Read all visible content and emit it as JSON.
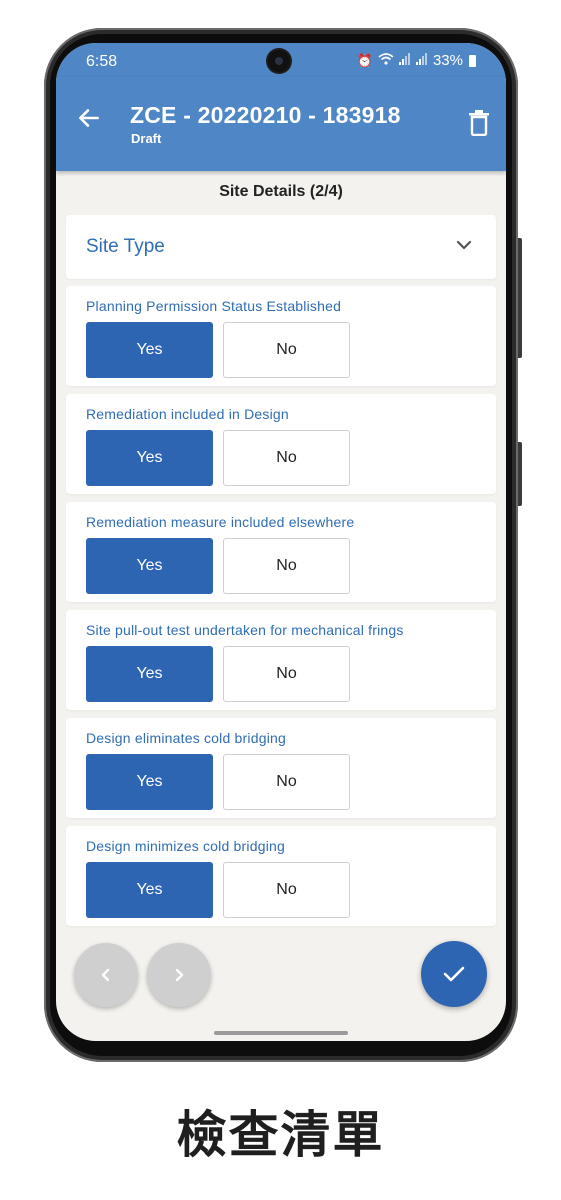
{
  "status_bar": {
    "time": "6:58",
    "battery": "33%"
  },
  "app_bar": {
    "title": "ZCE - 20220210 - 183918",
    "subtitle": "Draft"
  },
  "step": {
    "title": "Site Details (2/4)"
  },
  "site_type": {
    "label": "Site Type"
  },
  "questions": [
    {
      "label": "Planning Permission Status Established",
      "yes": "Yes",
      "no": "No",
      "selected": "Yes"
    },
    {
      "label": "Remediation included in Design",
      "yes": "Yes",
      "no": "No",
      "selected": "Yes"
    },
    {
      "label": "Remediation measure included elsewhere",
      "yes": "Yes",
      "no": "No",
      "selected": "Yes"
    },
    {
      "label": "Site pull-out test undertaken for mechanical frings",
      "yes": "Yes",
      "no": "No",
      "selected": "Yes"
    },
    {
      "label": "Design eliminates cold bridging",
      "yes": "Yes",
      "no": "No",
      "selected": "Yes"
    },
    {
      "label": "Design minimizes cold bridging",
      "yes": "Yes",
      "no": "No",
      "selected": "Yes"
    }
  ],
  "nav": {
    "prev_icon": "chevron-left-icon",
    "next_icon": "chevron-right-icon",
    "confirm_icon": "check-icon"
  },
  "caption": "檢查清單",
  "colors": {
    "app_bar": "#4f86c6",
    "primary": "#2e65b2",
    "label": "#2f6db5",
    "background": "#f3f2ee"
  }
}
